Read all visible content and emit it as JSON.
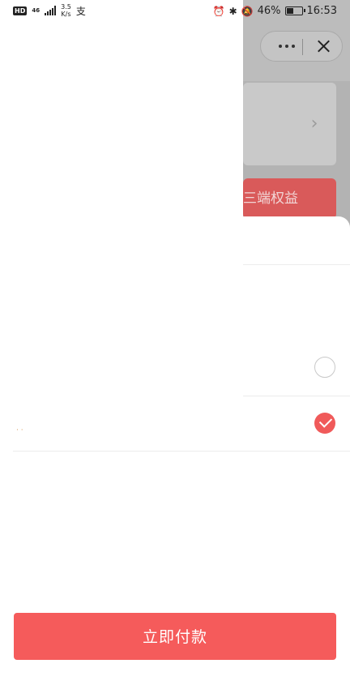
{
  "status_bar": {
    "hd": "HD",
    "network": "46",
    "speed_value": "3.5",
    "speed_unit": "K/s",
    "app_icon": "支",
    "battery_percent": "46%",
    "battery_level": 0.46,
    "time": "16:53"
  },
  "capsule": {
    "more_icon": "more-dots-icon",
    "close_icon": "close-icon"
  },
  "background": {
    "banner_text": "三端权益",
    "card_arrow": "›"
  },
  "payment_options": [
    {
      "selected": false
    },
    {
      "selected": true
    }
  ],
  "colors": {
    "accent": "#f55b5b",
    "check": "#f05a5a",
    "overlay": "#b3b3b3"
  },
  "pay_button": {
    "label": "立即付款"
  }
}
